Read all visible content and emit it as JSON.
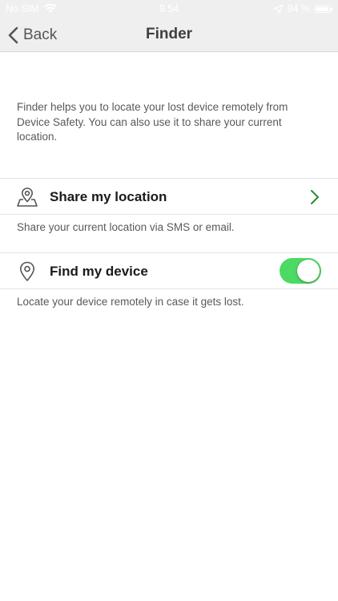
{
  "status_bar": {
    "carrier": "No SIM",
    "time": "9.54",
    "battery": "94 %",
    "battery_level": 0.94
  },
  "nav": {
    "back_label": "Back",
    "title": "Finder"
  },
  "intro_text": "Finder helps you to locate your lost device remotely from Device Safety. You can also use it to share your current location.",
  "items": [
    {
      "label": "Share my location",
      "description": "Share your current location via SMS or email.",
      "icon": "map-pin-icon",
      "accessory": "chevron-right-icon"
    },
    {
      "label": "Find my device",
      "description": "Locate your device remotely in case it gets lost.",
      "icon": "location-pin-icon",
      "toggle_on": true
    }
  ],
  "colors": {
    "accent_green": "#2e8b2e",
    "toggle_on": "#4cd964",
    "header_bg": "#efefef"
  }
}
